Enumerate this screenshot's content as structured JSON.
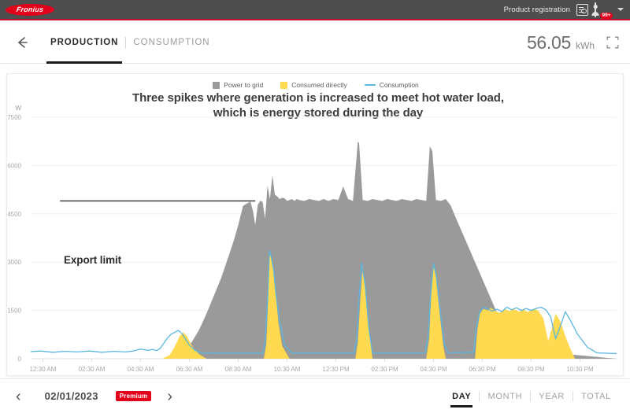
{
  "topbar": {
    "brand": "Fronius",
    "product_registration_label": "Product registration",
    "notification_count": "99+"
  },
  "header": {
    "tabs": [
      {
        "label": "PRODUCTION",
        "active": true
      },
      {
        "label": "CONSUMPTION",
        "active": false
      }
    ],
    "total_value": "56.05",
    "total_unit": "kWh"
  },
  "chart": {
    "title_line1": "Three spikes where generation is increased to meet hot water load,",
    "title_line2": "which is energy stored during the day",
    "annotation": "Export limit",
    "legend": [
      {
        "label": "Power to grid",
        "color": "#9a9a9a",
        "type": "area"
      },
      {
        "label": "Consumed directly",
        "color": "#ffd94f",
        "type": "area"
      },
      {
        "label": "Consumption",
        "color": "#5bb7e0",
        "type": "line"
      }
    ]
  },
  "footer": {
    "date": "02/01/2023",
    "premium_label": "Premium",
    "prev_label": "‹",
    "next_label": "›",
    "range_tabs": [
      {
        "label": "DAY",
        "active": true
      },
      {
        "label": "MONTH",
        "active": false
      },
      {
        "label": "YEAR",
        "active": false
      },
      {
        "label": "TOTAL",
        "active": false
      }
    ]
  },
  "chart_data": {
    "type": "area",
    "title": "Three spikes where generation is increased to meet hot water load, which is energy stored during the day",
    "xlabel": "",
    "ylabel": "W",
    "ylim": [
      0,
      7500
    ],
    "yticks": [
      0,
      1500,
      3000,
      4500,
      6000,
      7500
    ],
    "grid": true,
    "legend_position": "top-center",
    "xlim_hours": [
      0,
      24
    ],
    "xticks_hours": [
      0.5,
      2.5,
      4.5,
      6.5,
      8.5,
      10.5,
      12.5,
      14.5,
      16.5,
      18.5,
      20.5,
      22.5
    ],
    "xtick_labels": [
      "12:30 AM",
      "02:30 AM",
      "04:30 AM",
      "06:30 AM",
      "08:30 AM",
      "10:30 AM",
      "12:30 PM",
      "02:30 PM",
      "04:30 PM",
      "06:30 PM",
      "08:30 PM",
      "10:30 PM"
    ],
    "annotations": [
      {
        "text": "Export limit",
        "value": 4900,
        "x_start_hour": 1.2,
        "x_end_hour": 9.2
      }
    ],
    "series": [
      {
        "name": "Power to grid",
        "color": "#9a9a9a",
        "kind": "area",
        "x": [
          0,
          5.6,
          6.0,
          6.3,
          6.6,
          6.9,
          7.2,
          7.5,
          7.8,
          8.0,
          8.2,
          8.35,
          8.5,
          8.6,
          8.7,
          8.85,
          9.0,
          9.1,
          9.2,
          9.3,
          9.4,
          9.5,
          9.6,
          9.7,
          9.8,
          9.9,
          10.0,
          10.1,
          10.2,
          10.3,
          10.4,
          10.5,
          10.6,
          10.7,
          10.8,
          10.9,
          11.0,
          11.2,
          11.4,
          11.6,
          11.8,
          12.0,
          12.2,
          12.4,
          12.6,
          12.8,
          13.0,
          13.2,
          13.4,
          13.45,
          13.6,
          13.8,
          14.0,
          14.2,
          14.4,
          14.6,
          14.8,
          15.0,
          15.2,
          15.4,
          15.6,
          15.8,
          16.0,
          16.2,
          16.35,
          16.45,
          16.6,
          16.8,
          17.0,
          17.2,
          17.4,
          17.6,
          17.8,
          18.0,
          18.2,
          18.4,
          18.6,
          18.8,
          19.0,
          19.2,
          19.4,
          19.6,
          19.8,
          20.0,
          20.2,
          20.4,
          20.6,
          20.8,
          21.0,
          21.2,
          21.4,
          24
        ],
        "y": [
          0,
          0,
          80,
          260,
          520,
          900,
          1400,
          1950,
          2500,
          2950,
          3400,
          3750,
          4150,
          4450,
          4750,
          4820,
          4880,
          4600,
          4150,
          4780,
          4900,
          4870,
          4350,
          5380,
          4960,
          5700,
          5100,
          5040,
          4960,
          5000,
          4980,
          4900,
          4930,
          4960,
          4900,
          4960,
          4930,
          4900,
          4960,
          4930,
          4900,
          4960,
          4900,
          4960,
          4930,
          5350,
          4960,
          4900,
          6750,
          6700,
          4930,
          4900,
          4960,
          4930,
          4900,
          4960,
          4930,
          4900,
          4960,
          4930,
          4900,
          4960,
          4930,
          4900,
          6600,
          6450,
          4930,
          4900,
          4960,
          4760,
          4400,
          4050,
          3700,
          3350,
          3000,
          2650,
          2300,
          1950,
          1600,
          1250,
          1000,
          1250,
          900,
          600,
          1100,
          850,
          1500,
          1350,
          900,
          500,
          180,
          0
        ]
      },
      {
        "name": "Consumed directly",
        "color": "#ffd94f",
        "kind": "area",
        "x": [
          0,
          5.4,
          5.7,
          5.9,
          6.1,
          6.25,
          6.4,
          6.55,
          6.7,
          6.9,
          7.2,
          9.55,
          9.65,
          9.72,
          9.78,
          9.85,
          9.95,
          10.05,
          10.15,
          10.3,
          10.6,
          13.3,
          13.4,
          13.5,
          13.6,
          13.7,
          13.85,
          14.0,
          16.2,
          16.32,
          16.4,
          16.5,
          16.6,
          16.75,
          16.9,
          17.0,
          18.2,
          18.3,
          18.4,
          18.55,
          18.7,
          18.85,
          19.0,
          19.2,
          19.4,
          19.6,
          19.8,
          20.0,
          20.2,
          20.35,
          20.5,
          20.65,
          20.8,
          21.0,
          21.2,
          21.35,
          21.5,
          21.7,
          21.9,
          22.1,
          22.3,
          24
        ],
        "y": [
          0,
          0,
          120,
          380,
          700,
          820,
          700,
          480,
          300,
          140,
          0,
          0,
          450,
          1700,
          3280,
          3100,
          2700,
          1900,
          1100,
          400,
          0,
          0,
          500,
          1800,
          2900,
          2200,
          900,
          0,
          0,
          600,
          1900,
          2900,
          2500,
          1400,
          400,
          0,
          0,
          900,
          1400,
          1550,
          1500,
          1580,
          1500,
          1420,
          1550,
          1480,
          1540,
          1460,
          1520,
          1450,
          1500,
          1550,
          1480,
          1250,
          550,
          950,
          1400,
          1150,
          700,
          320,
          0,
          0
        ]
      },
      {
        "name": "Consumption",
        "color": "#5bb7e0",
        "kind": "line",
        "x": [
          0,
          0.4,
          0.9,
          1.4,
          1.9,
          2.4,
          2.9,
          3.4,
          3.9,
          4.2,
          4.5,
          4.8,
          5.0,
          5.15,
          5.3,
          5.45,
          5.6,
          5.75,
          5.9,
          6.05,
          6.2,
          6.35,
          6.5,
          6.7,
          6.9,
          7.1,
          7.4,
          9.5,
          9.6,
          9.7,
          9.78,
          9.85,
          9.95,
          10.05,
          10.2,
          10.4,
          10.7,
          13.25,
          13.35,
          13.45,
          13.55,
          13.7,
          13.85,
          14.0,
          16.15,
          16.28,
          16.38,
          16.5,
          16.62,
          16.78,
          16.95,
          17.1,
          18.15,
          18.25,
          18.4,
          18.55,
          18.7,
          18.9,
          19.1,
          19.3,
          19.5,
          19.7,
          19.9,
          20.1,
          20.3,
          20.5,
          20.7,
          20.9,
          21.1,
          21.3,
          21.5,
          21.7,
          21.9,
          22.1,
          22.4,
          22.8,
          23.2,
          24
        ],
        "y": [
          220,
          240,
          200,
          230,
          210,
          240,
          200,
          230,
          210,
          240,
          300,
          260,
          290,
          250,
          320,
          480,
          640,
          760,
          820,
          880,
          780,
          600,
          420,
          280,
          200,
          180,
          180,
          170,
          520,
          1800,
          3350,
          3180,
          2760,
          1980,
          1150,
          420,
          180,
          180,
          560,
          1880,
          2980,
          2300,
          960,
          180,
          180,
          680,
          1980,
          2960,
          2560,
          1460,
          440,
          180,
          200,
          960,
          1460,
          1600,
          1550,
          1480,
          1540,
          1460,
          1600,
          1520,
          1580,
          1500,
          1560,
          1500,
          1560,
          1600,
          1520,
          1300,
          620,
          1020,
          1460,
          1200,
          760,
          360,
          180,
          160
        ]
      }
    ]
  }
}
